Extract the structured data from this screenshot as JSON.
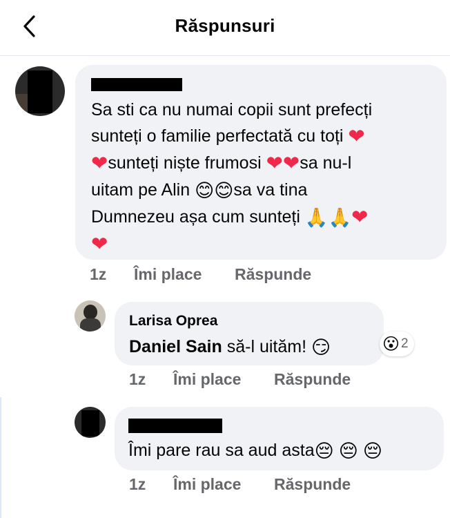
{
  "header": {
    "title": "Răspunsuri",
    "back_icon": "chevron-left-icon"
  },
  "comment1": {
    "author_redacted": true,
    "lines": [
      "Sa sti ca nu numai copii sunt prefecți",
      "sunteți o familie perfectată cu toți",
      "sunteți niște frumosi",
      "sa nu-l",
      "uitam pe Alin",
      "sa va tina",
      "Dumnezeu așa cum sunteți"
    ],
    "emojis": {
      "heart": "❤",
      "smile": "😊",
      "pray": "🙏"
    },
    "time": "1z",
    "like": "Îmi place",
    "reply": "Răspunde"
  },
  "reply1": {
    "author": "Larisa Oprea",
    "mention": "Daniel Sain",
    "text": "să-l uităm!",
    "emoji": "😏",
    "reaction_emoji": "😮",
    "reaction_count": "2",
    "time": "1z",
    "like": "Îmi place",
    "reply": "Răspunde"
  },
  "reply2": {
    "author_redacted": true,
    "text": "Îmi pare rau sa aud asta",
    "emoji": "😔",
    "time": "1z",
    "like": "Îmi place",
    "reply": "Răspunde"
  },
  "colors": {
    "bubble": "#f0f2f5",
    "meta": "#65676b",
    "heart": "#f02849"
  }
}
